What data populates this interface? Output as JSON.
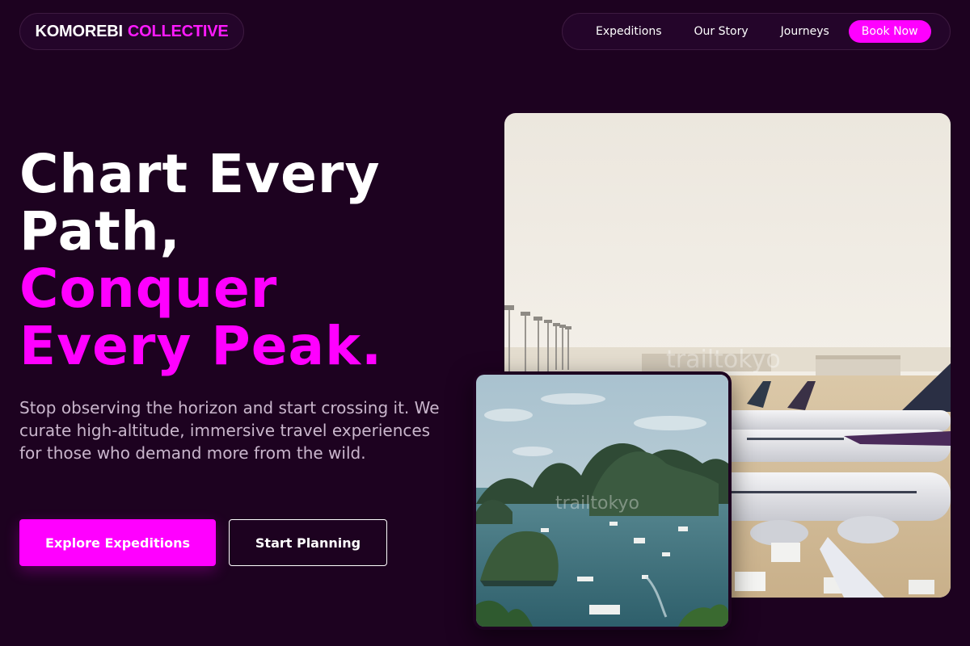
{
  "header": {
    "brand_part1": "KOMOREBI",
    "brand_part2": "COLLECTIVE",
    "nav": [
      "Expeditions",
      "Our Story",
      "Journeys"
    ],
    "cta": "Book Now"
  },
  "hero": {
    "title_line1": "Chart Every",
    "title_line2": "Path,",
    "title_line3": "Conquer",
    "title_line4": "Every Peak.",
    "subtitle": "Stop observing the horizon and start crossing it. We curate high-altitude, immersive travel experiences for those who demand more from the wild.",
    "primary_button": "Explore Expeditions",
    "secondary_button": "Start Planning"
  },
  "images": {
    "main_watermark": "trailtokyo",
    "inset_watermark": "trailtokyo"
  },
  "colors": {
    "background": "#1d0220",
    "accent": "#ff00ff",
    "text": "#ffffff",
    "muted": "#c9b6cc"
  }
}
